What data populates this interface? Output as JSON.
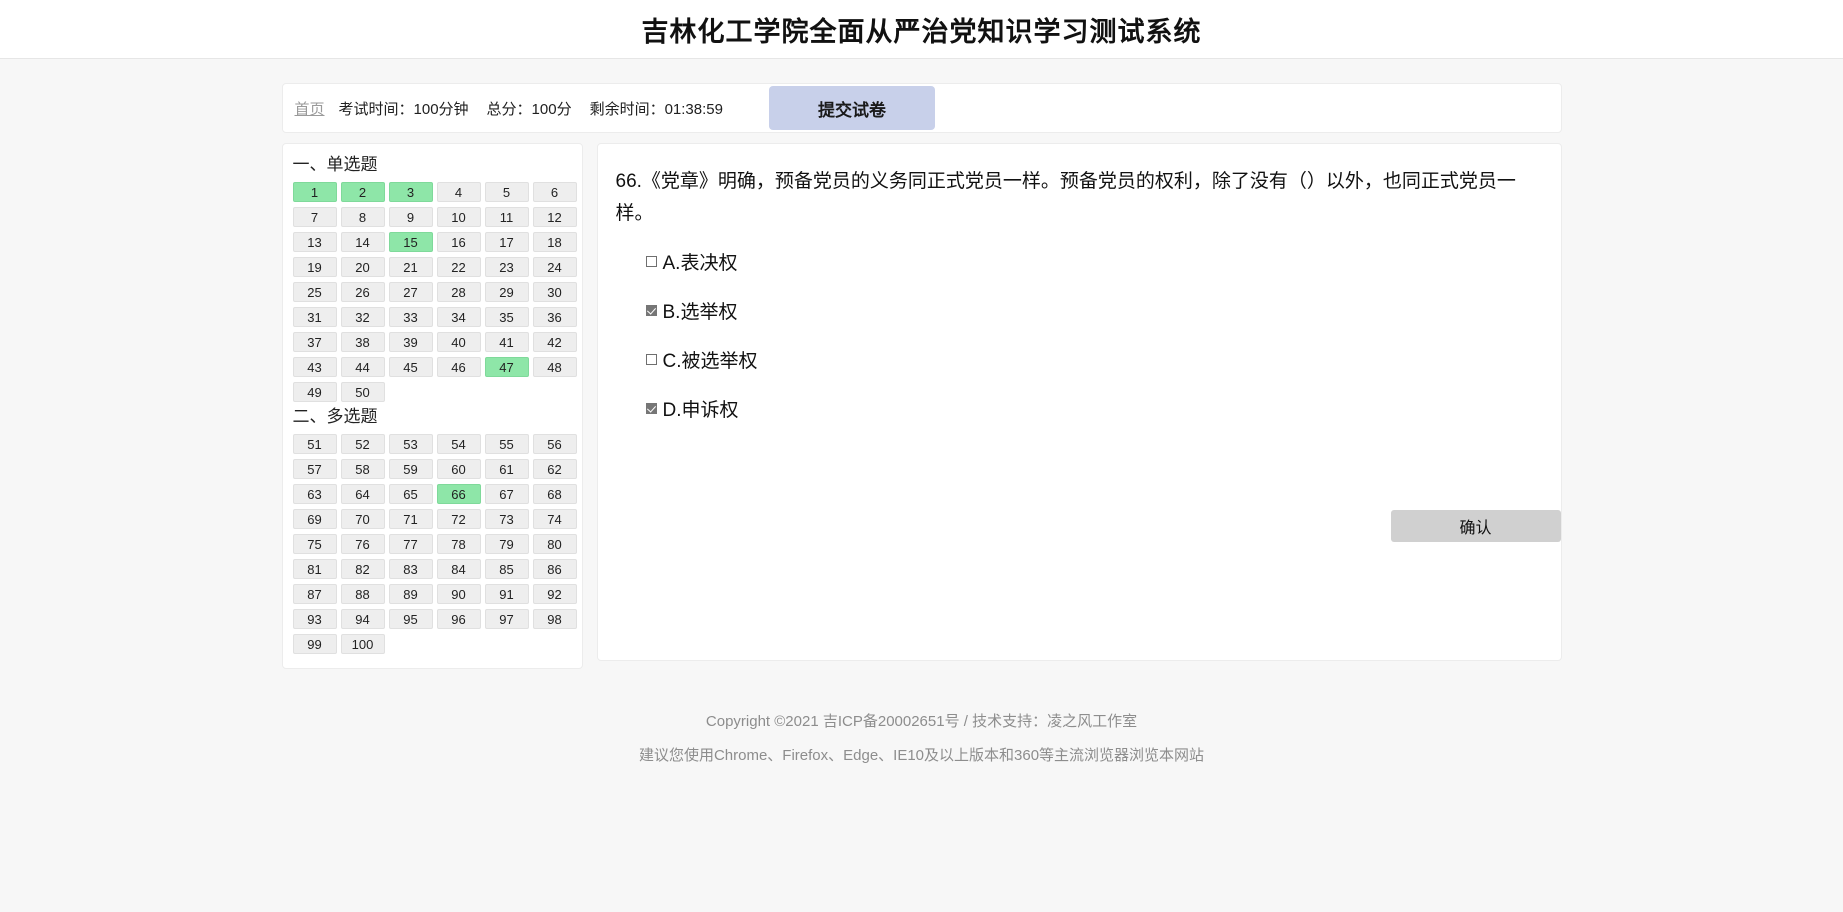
{
  "header": {
    "title": "吉林化工学院全面从严治党知识学习测试系统"
  },
  "toolbar": {
    "home_link": "首页",
    "exam_duration": "考试时间：100分钟",
    "total_score": "总分：100分",
    "remaining_time": "剩余时间：01:38:59",
    "submit_label": "提交试卷",
    "submit_bg": "#c8d0ea"
  },
  "nav": {
    "answered_color": "#8ee6a8",
    "default_color": "#eeeeee",
    "sections": [
      {
        "title": "一、单选题",
        "questions": [
          {
            "n": "1",
            "answered": true
          },
          {
            "n": "2",
            "answered": true
          },
          {
            "n": "3",
            "answered": true
          },
          {
            "n": "4",
            "answered": false
          },
          {
            "n": "5",
            "answered": false
          },
          {
            "n": "6",
            "answered": false
          },
          {
            "n": "7",
            "answered": false
          },
          {
            "n": "8",
            "answered": false
          },
          {
            "n": "9",
            "answered": false
          },
          {
            "n": "10",
            "answered": false
          },
          {
            "n": "11",
            "answered": false
          },
          {
            "n": "12",
            "answered": false
          },
          {
            "n": "13",
            "answered": false
          },
          {
            "n": "14",
            "answered": false
          },
          {
            "n": "15",
            "answered": true
          },
          {
            "n": "16",
            "answered": false
          },
          {
            "n": "17",
            "answered": false
          },
          {
            "n": "18",
            "answered": false
          },
          {
            "n": "19",
            "answered": false
          },
          {
            "n": "20",
            "answered": false
          },
          {
            "n": "21",
            "answered": false
          },
          {
            "n": "22",
            "answered": false
          },
          {
            "n": "23",
            "answered": false
          },
          {
            "n": "24",
            "answered": false
          },
          {
            "n": "25",
            "answered": false
          },
          {
            "n": "26",
            "answered": false
          },
          {
            "n": "27",
            "answered": false
          },
          {
            "n": "28",
            "answered": false
          },
          {
            "n": "29",
            "answered": false
          },
          {
            "n": "30",
            "answered": false
          },
          {
            "n": "31",
            "answered": false
          },
          {
            "n": "32",
            "answered": false
          },
          {
            "n": "33",
            "answered": false
          },
          {
            "n": "34",
            "answered": false
          },
          {
            "n": "35",
            "answered": false
          },
          {
            "n": "36",
            "answered": false
          },
          {
            "n": "37",
            "answered": false
          },
          {
            "n": "38",
            "answered": false
          },
          {
            "n": "39",
            "answered": false
          },
          {
            "n": "40",
            "answered": false
          },
          {
            "n": "41",
            "answered": false
          },
          {
            "n": "42",
            "answered": false
          },
          {
            "n": "43",
            "answered": false
          },
          {
            "n": "44",
            "answered": false
          },
          {
            "n": "45",
            "answered": false
          },
          {
            "n": "46",
            "answered": false
          },
          {
            "n": "47",
            "answered": true
          },
          {
            "n": "48",
            "answered": false
          },
          {
            "n": "49",
            "answered": false
          },
          {
            "n": "50",
            "answered": false
          }
        ]
      },
      {
        "title": "二、多选题",
        "questions": [
          {
            "n": "51",
            "answered": false
          },
          {
            "n": "52",
            "answered": false
          },
          {
            "n": "53",
            "answered": false
          },
          {
            "n": "54",
            "answered": false
          },
          {
            "n": "55",
            "answered": false
          },
          {
            "n": "56",
            "answered": false
          },
          {
            "n": "57",
            "answered": false
          },
          {
            "n": "58",
            "answered": false
          },
          {
            "n": "59",
            "answered": false
          },
          {
            "n": "60",
            "answered": false
          },
          {
            "n": "61",
            "answered": false
          },
          {
            "n": "62",
            "answered": false
          },
          {
            "n": "63",
            "answered": false
          },
          {
            "n": "64",
            "answered": false
          },
          {
            "n": "65",
            "answered": false
          },
          {
            "n": "66",
            "answered": true
          },
          {
            "n": "67",
            "answered": false
          },
          {
            "n": "68",
            "answered": false
          },
          {
            "n": "69",
            "answered": false
          },
          {
            "n": "70",
            "answered": false
          },
          {
            "n": "71",
            "answered": false
          },
          {
            "n": "72",
            "answered": false
          },
          {
            "n": "73",
            "answered": false
          },
          {
            "n": "74",
            "answered": false
          },
          {
            "n": "75",
            "answered": false
          },
          {
            "n": "76",
            "answered": false
          },
          {
            "n": "77",
            "answered": false
          },
          {
            "n": "78",
            "answered": false
          },
          {
            "n": "79",
            "answered": false
          },
          {
            "n": "80",
            "answered": false
          },
          {
            "n": "81",
            "answered": false
          },
          {
            "n": "82",
            "answered": false
          },
          {
            "n": "83",
            "answered": false
          },
          {
            "n": "84",
            "answered": false
          },
          {
            "n": "85",
            "answered": false
          },
          {
            "n": "86",
            "answered": false
          },
          {
            "n": "87",
            "answered": false
          },
          {
            "n": "88",
            "answered": false
          },
          {
            "n": "89",
            "answered": false
          },
          {
            "n": "90",
            "answered": false
          },
          {
            "n": "91",
            "answered": false
          },
          {
            "n": "92",
            "answered": false
          },
          {
            "n": "93",
            "answered": false
          },
          {
            "n": "94",
            "answered": false
          },
          {
            "n": "95",
            "answered": false
          },
          {
            "n": "96",
            "answered": false
          },
          {
            "n": "97",
            "answered": false
          },
          {
            "n": "98",
            "answered": false
          },
          {
            "n": "99",
            "answered": false
          },
          {
            "n": "100",
            "answered": false
          }
        ]
      }
    ]
  },
  "question": {
    "number": "66.",
    "stem": "66.《党章》明确，预备党员的义务同正式党员一样。预备党员的权利，除了没有（）以外，也同正式党员一样。",
    "options": [
      {
        "label": "A.表决权",
        "checked": false
      },
      {
        "label": "B.选举权",
        "checked": true
      },
      {
        "label": "C.被选举权",
        "checked": false
      },
      {
        "label": "D.申诉权",
        "checked": true
      }
    ],
    "confirm_label": "确认"
  },
  "footer": {
    "line1": "Copyright ©2021 吉ICP备20002651号 / 技术支持：凌之风工作室",
    "line2": "建议您使用Chrome、Firefox、Edge、IE10及以上版本和360等主流浏览器浏览本网站"
  }
}
